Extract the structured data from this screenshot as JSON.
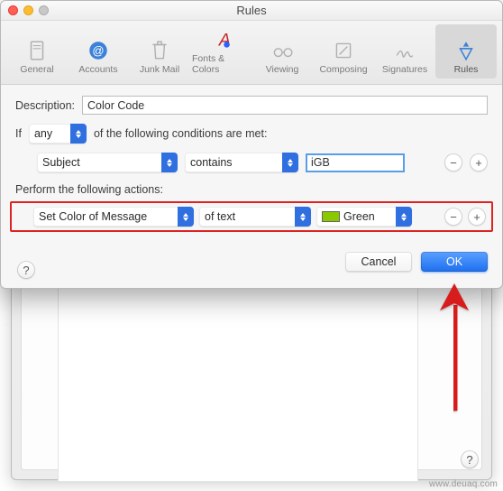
{
  "window_title": "Rules",
  "toolbar": {
    "items": [
      {
        "label": "General"
      },
      {
        "label": "Accounts"
      },
      {
        "label": "Junk Mail"
      },
      {
        "label": "Fonts & Colors"
      },
      {
        "label": "Viewing"
      },
      {
        "label": "Composing"
      },
      {
        "label": "Signatures"
      },
      {
        "label": "Rules"
      }
    ]
  },
  "description_label": "Description:",
  "description_value": "Color Code",
  "if_label": "If",
  "if_scope": "any",
  "if_suffix": "of the following conditions are met:",
  "condition": {
    "field": "Subject",
    "operator": "contains",
    "value": "iGB"
  },
  "actions_label": "Perform the following actions:",
  "action": {
    "type": "Set Color of Message",
    "target": "of text",
    "color_name": "Green",
    "color_hex": "#8ac800"
  },
  "buttons": {
    "cancel": "Cancel",
    "ok": "OK"
  },
  "help_glyph": "?",
  "watermark": "www.deuaq.com"
}
